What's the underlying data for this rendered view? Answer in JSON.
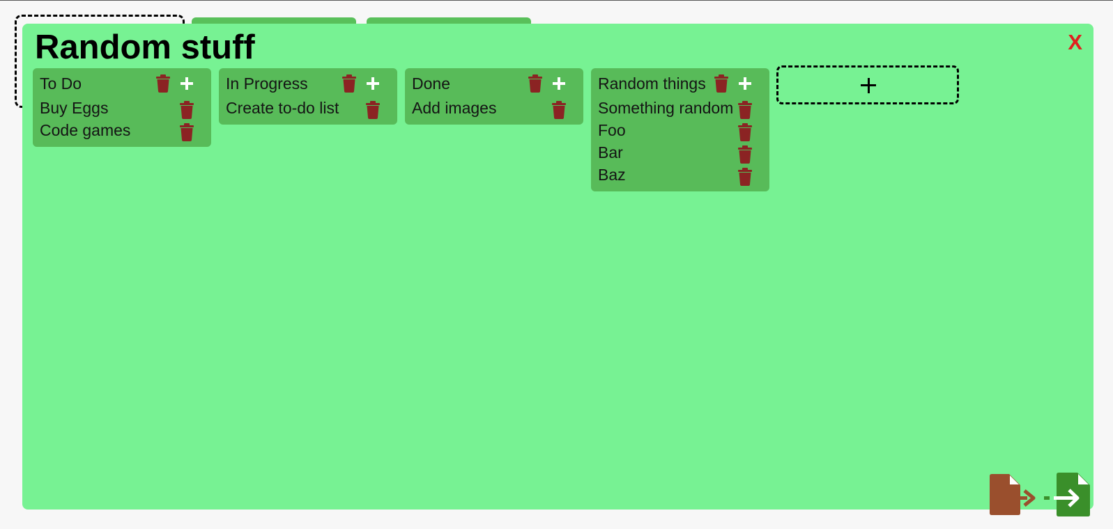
{
  "board": {
    "title": "Random stuff",
    "close_label": "X"
  },
  "lists": [
    {
      "title": "To Do",
      "items": [
        "Buy Eggs",
        "Code games"
      ]
    },
    {
      "title": "In Progress",
      "items": [
        "Create to-do list"
      ]
    },
    {
      "title": "Done",
      "items": [
        "Add images"
      ]
    },
    {
      "title": "Random things",
      "items": [
        "Something random",
        "Foo",
        "Bar",
        "Baz"
      ]
    }
  ],
  "icons": {
    "trash": "trash-icon",
    "add": "plus-icon",
    "export": "file-export-icon",
    "import": "file-import-icon"
  },
  "colors": {
    "board_background": "#77f293",
    "list_background": "#58bb59",
    "trash": "#8b2323",
    "close": "#e0201f",
    "export_icon": "#9a4f2d",
    "import_icon": "#3a8f2a"
  }
}
